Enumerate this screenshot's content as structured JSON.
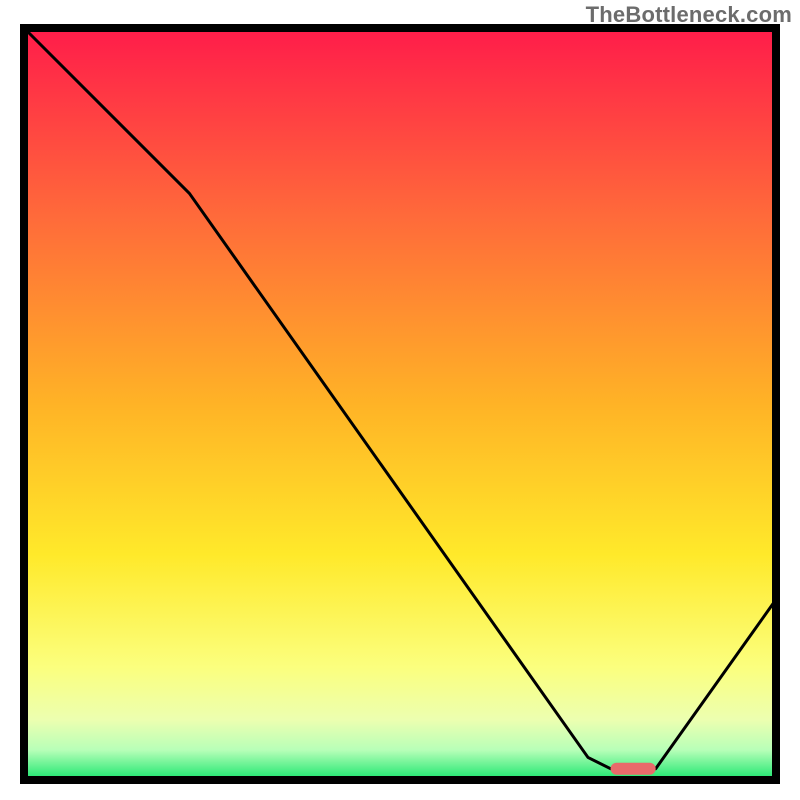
{
  "watermark": "TheBottleneck.com",
  "chart_data": {
    "type": "line",
    "title": "",
    "xlabel": "",
    "ylabel": "",
    "xlim": [
      0,
      100
    ],
    "ylim": [
      0,
      100
    ],
    "grid": false,
    "legend": false,
    "annotations": [
      {
        "name": "optimal-marker",
        "color": "#e86a6a",
        "x_start": 78,
        "x_end": 84,
        "y": 1.5
      }
    ],
    "series": [
      {
        "name": "bottleneck-curve",
        "color": "#000000",
        "x": [
          0,
          22,
          75,
          78,
          84,
          100
        ],
        "values": [
          100,
          78,
          3,
          1.5,
          1.5,
          24
        ]
      }
    ],
    "background_gradient": {
      "stops": [
        {
          "offset": 0.0,
          "color": "#ff1c4a"
        },
        {
          "offset": 0.25,
          "color": "#ff6a3a"
        },
        {
          "offset": 0.5,
          "color": "#ffb326"
        },
        {
          "offset": 0.7,
          "color": "#ffe92a"
        },
        {
          "offset": 0.85,
          "color": "#fbff7e"
        },
        {
          "offset": 0.92,
          "color": "#ecffb0"
        },
        {
          "offset": 0.96,
          "color": "#b8ffb8"
        },
        {
          "offset": 1.0,
          "color": "#19e66e"
        }
      ]
    },
    "plot_frame": {
      "stroke": "#000000",
      "stroke_width": 8
    }
  }
}
